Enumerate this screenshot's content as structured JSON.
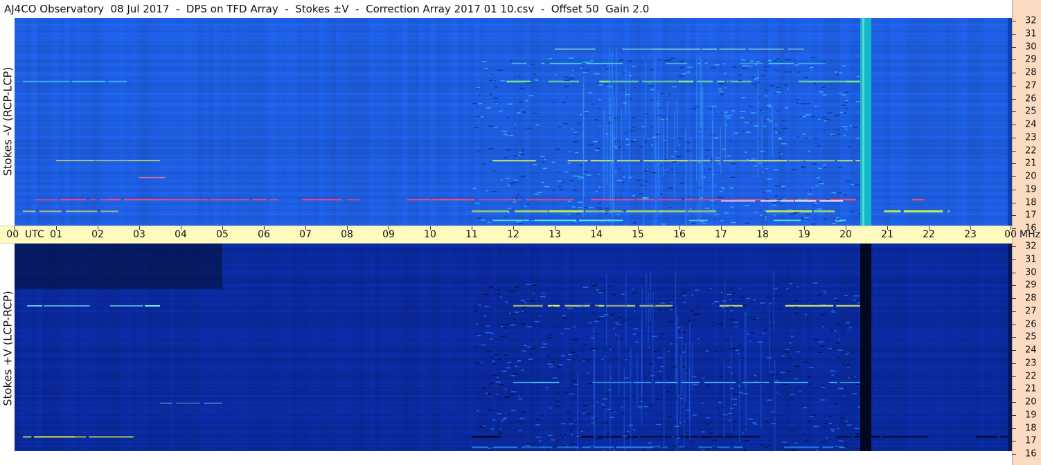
{
  "header": {
    "title": "AJ4CO Observatory  08 Jul 2017  -  DPS on TFD Array  -  Stokes ±V  -  Correction Array 2017 01 10.csv  -  Offset 50  Gain 2.0"
  },
  "chart_data": [
    {
      "type": "heatmap",
      "ylabel": "Stokes -V (RCP-LCP)",
      "y_unit": "MHz",
      "x_unit": "UTC",
      "x_ticks": [
        "00",
        "01",
        "02",
        "03",
        "04",
        "05",
        "06",
        "07",
        "08",
        "09",
        "10",
        "11",
        "12",
        "13",
        "14",
        "15",
        "16",
        "17",
        "18",
        "19",
        "20",
        "21",
        "22",
        "23",
        "00"
      ],
      "y_ticks": [
        "32",
        "31",
        "30",
        "29",
        "28",
        "27",
        "26",
        "25",
        "24",
        "23",
        "22",
        "21",
        "20",
        "19",
        "18",
        "17",
        "16"
      ],
      "xlim": [
        0,
        24
      ],
      "ylim": [
        16,
        32
      ],
      "colors": {
        "background": "#1e5ee0",
        "low": "#0f3fb8",
        "high": "#ff3366",
        "mid": "#33e6c8"
      }
    },
    {
      "type": "heatmap",
      "ylabel": "Stokes +V (LCP-RCP)",
      "y_unit": "MHz",
      "x_unit": "UTC",
      "x_ticks": [
        "00",
        "01",
        "02",
        "03",
        "04",
        "05",
        "06",
        "07",
        "08",
        "09",
        "10",
        "11",
        "12",
        "13",
        "14",
        "15",
        "16",
        "17",
        "18",
        "19",
        "20",
        "21",
        "22",
        "23",
        "00"
      ],
      "y_ticks": [
        "32",
        "31",
        "30",
        "29",
        "28",
        "27",
        "26",
        "25",
        "24",
        "23",
        "22",
        "21",
        "20",
        "19",
        "18",
        "17",
        "16"
      ],
      "xlim": [
        0,
        24
      ],
      "ylim": [
        16,
        32
      ],
      "colors": {
        "background": "#0b2a9e",
        "low": "#061447",
        "high": "#e6f04a",
        "mid": "#3aa0ff"
      }
    }
  ],
  "axis": {
    "utc_label": "UTC",
    "mhz_label": "MHz",
    "time_labels": [
      "00",
      "01",
      "02",
      "03",
      "04",
      "05",
      "06",
      "07",
      "08",
      "09",
      "10",
      "11",
      "12",
      "13",
      "14",
      "15",
      "16",
      "17",
      "18",
      "19",
      "20",
      "21",
      "22",
      "23",
      "00"
    ]
  }
}
